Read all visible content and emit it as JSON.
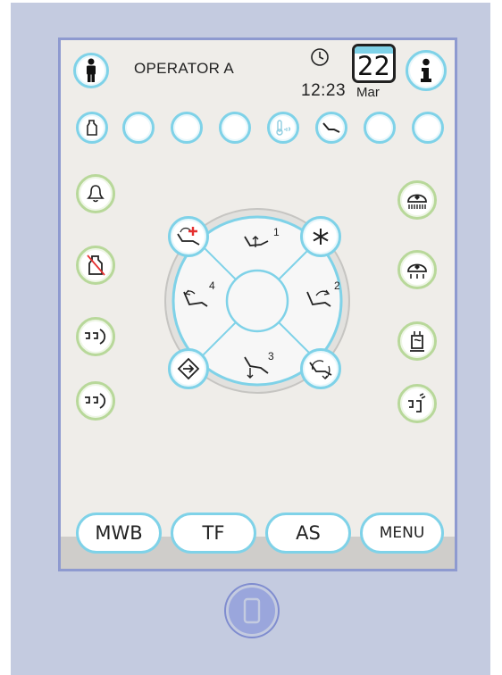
{
  "header": {
    "operator_label": "OPERATOR A",
    "time": "12:23",
    "date_day": "22",
    "date_month": "Mar"
  },
  "status_row": [
    {
      "icon": "spittoon-icon",
      "active": true
    },
    {
      "icon": "empty",
      "active": false
    },
    {
      "icon": "empty",
      "active": false
    },
    {
      "icon": "empty",
      "active": false
    },
    {
      "icon": "water-temperature-icon",
      "active": false
    },
    {
      "icon": "chair-icon",
      "active": true
    },
    {
      "icon": "empty",
      "active": false
    },
    {
      "icon": "empty",
      "active": false
    }
  ],
  "left_column": [
    "bell-icon",
    "spittoon-off-icon",
    "cup-fill-icon",
    "cup-fill-icon"
  ],
  "right_column": [
    "operating-light-icon",
    "operating-light-dim-icon",
    "cup-heater-icon",
    "cup-rinse-icon"
  ],
  "dial": {
    "positions": [
      {
        "label": "1",
        "icon": "chair-position-1-icon"
      },
      {
        "label": "2",
        "icon": "chair-position-2-icon"
      },
      {
        "label": "3",
        "icon": "chair-position-3-icon"
      },
      {
        "label": "4",
        "icon": "chair-position-4-icon"
      }
    ],
    "corner_buttons": [
      "emergency-position-icon",
      "asterisk-icon",
      "enter-icon",
      "return-position-icon"
    ]
  },
  "bottom_buttons": {
    "mwb": "MWB",
    "tf": "TF",
    "as": "AS",
    "menu": "MENU"
  },
  "colors": {
    "accent_blue": "#7fd2e8",
    "accent_green": "#b8d89a",
    "screen_bg": "#efede9",
    "frame": "#8e9ad0",
    "device_bg": "#c4cbe0",
    "emergency_red": "#e53030"
  }
}
